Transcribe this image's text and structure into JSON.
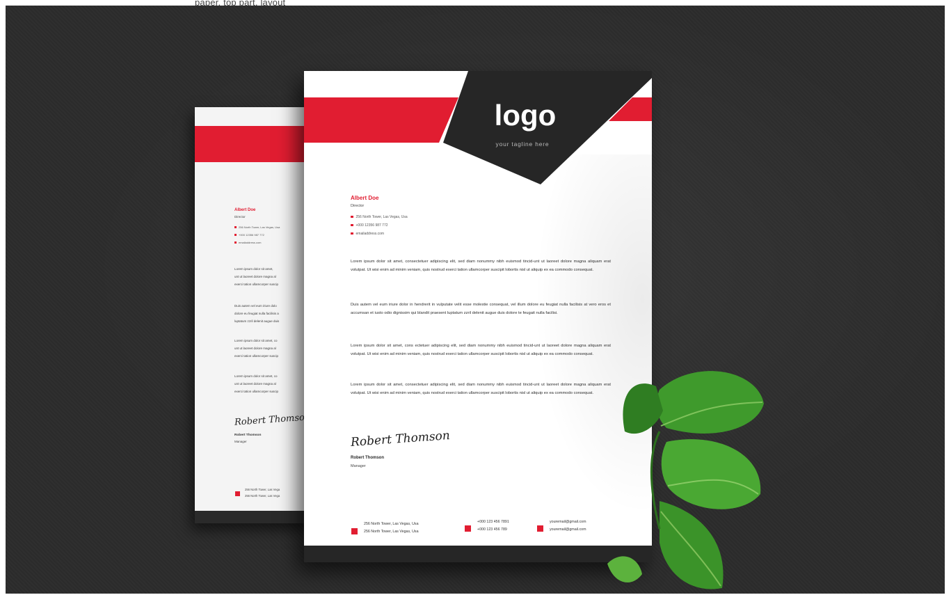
{
  "top_fragment": "paper, top part, layout",
  "colors": {
    "accent": "#e11d31",
    "dark": "#262626",
    "background": "#2c2c2c"
  },
  "back_sheet": {
    "name": "Albert Doe",
    "title": "Director",
    "contacts": [
      "256 North Tower, Las Vegas, Usa",
      "+000 12356 987 772",
      "emailaddress.com"
    ],
    "paragraphs": [
      [
        "Lorem ipsum dolor sit amet,",
        "unt ut laoreet dolore magna al",
        "exerci tation ullamcorper suscip"
      ],
      [
        "Duis autem vel eum iriure dolo",
        "dolore eu feugiat nulla facilisis a",
        "luptatum zzril delenit augue duis"
      ],
      [
        "Lorem ipsum dolor sit amet, co",
        "unt ut laoreet dolore magna al",
        "exerci tation ullamcorper suscip"
      ],
      [
        "Lorem ipsum dolor sit amet, co",
        "unt ut laoreet dolore magna al",
        "exerci tation ullamcorper suscip"
      ]
    ],
    "signature": "Robert Thomson",
    "signer_name": "Robert Thomson",
    "signer_role": "Manager",
    "footer": [
      "256 North Tower, Las Vega",
      "256 North Tower, Las Vega"
    ]
  },
  "front_sheet": {
    "logo": "logo",
    "tagline": "your tagline here",
    "name": "Albert Doe",
    "title": "Director",
    "contacts": [
      "256 North Tower, Las Vegas, Usa",
      "+000 12356 987 772",
      "emailaddress.com"
    ],
    "paragraphs": [
      "Lorem ipsum dolor sit amet, consectetuer adipiscing elit, sed diam nonummy nibh euismod tincid-unt ut laoreet dolore magna aliquam erat volutpat. Ut wisi enim ad minim veniam, quis nostrud exerci tation ullamcorper suscipit lobortis nisl ut aliquip ex ea commodo consequat.",
      "Duis autem vel eum iriure dolor in hendrerit in vulputate velit esse molestie consequat, vel illum dolore eu feugiat nulla facilisis at vero eros et accumsan et iusto odio dignissim qui blandit praesent luptatum zzril delenit augue duis dolore te feugait nulla facilisi.",
      "Lorem ipsum dolor sit amet, cons ectetuer adipiscing elit, sed diam nonummy nibh euismod tincid-unt ut laoreet dolore magna aliquam erat volutpat. Ut wisi enim ad minim veniam, quis nostrud exerci tation ullamcorper suscipit lobortis nisl ut aliquip ex ea commodo consequat.",
      "Lorem ipsum dolor sit amet, consectetuer adipiscing elit, sed diam nonummy nibh euismod tincid-unt ut laoreet dolore magna aliquam erat volutpat. Ut wisi enim ad minim veniam, quis nostrud exerci tation ullamcorper suscipit lobortis nisl ut aliquip ex ea commodo consequat."
    ],
    "signature": "Robert Thomson",
    "signer_name": "Robert Thomson",
    "signer_role": "Manager",
    "footer": {
      "address": [
        "256 North Tower, Las Vegas, Usa",
        "256 North Tower, Las Vegas, Usa"
      ],
      "phone": [
        "+000 123 456 7891",
        "+000 123 456 789"
      ],
      "email": [
        "youremail@gmail.com",
        "youremail@gmail.com"
      ]
    }
  },
  "icons": [
    "map-pin-icon",
    "phone-icon",
    "mail-icon",
    "location-icon"
  ]
}
